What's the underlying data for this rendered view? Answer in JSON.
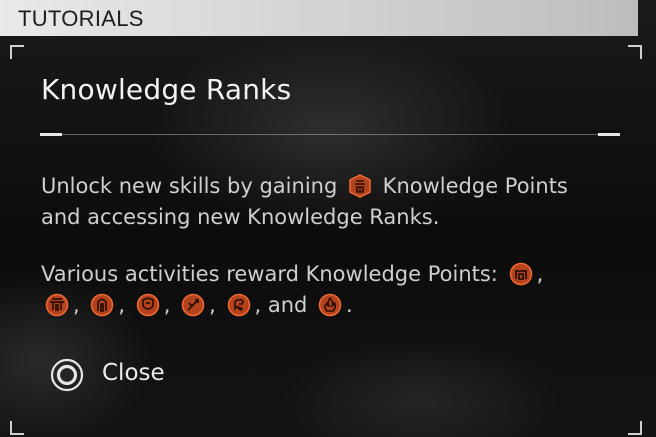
{
  "header": {
    "title": "TUTORIALS"
  },
  "panel": {
    "title": "Knowledge Ranks",
    "para1": {
      "before": "Unlock new skills by gaining",
      "after": "Knowledge Points and accessing new Knowledge Ranks."
    },
    "para2": {
      "intro": "Various activities reward Knowledge Points:",
      "sep": ",",
      "and": ", and",
      "end": "."
    },
    "icons": [
      "knowledge-points-icon",
      "shrine-icon",
      "gate-icon",
      "temple-icon",
      "shield-icon",
      "combat-icon",
      "hand-icon",
      "flame-icon"
    ],
    "accent_color": "#d9592b"
  },
  "footer": {
    "close_label": "Close"
  }
}
